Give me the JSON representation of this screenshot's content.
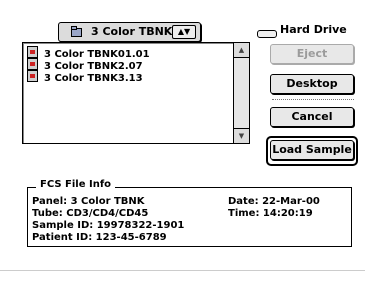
{
  "popup": {
    "label": "3 Color TBNK",
    "icon": "folder-icon",
    "arrows": "▲▼"
  },
  "files": [
    {
      "name": "3 Color TBNK01.01",
      "icon": "document-icon"
    },
    {
      "name": "3 Color TBNK2.07",
      "icon": "document-icon"
    },
    {
      "name": "3 Color TBNK3.13",
      "icon": "document-icon"
    }
  ],
  "volume": {
    "label": "Hard Drive",
    "icon": "hard-drive-icon"
  },
  "buttons": {
    "eject": "Eject",
    "desktop": "Desktop",
    "cancel": "Cancel",
    "load": "Load Sample"
  },
  "info": {
    "legend": "FCS File Info",
    "panel": "Panel: 3 Color TBNK",
    "tube": "Tube: CD3/CD4/CD45",
    "sample_id": "Sample ID: 19978322-1901",
    "patient_id": "Patient ID: 123-45-6789",
    "date": "Date: 22-Mar-00",
    "time": "Time: 14:20:19"
  },
  "scrollbar": {
    "up_icon": "scroll-up-arrow-icon",
    "down_icon": "scroll-down-arrow-icon"
  }
}
